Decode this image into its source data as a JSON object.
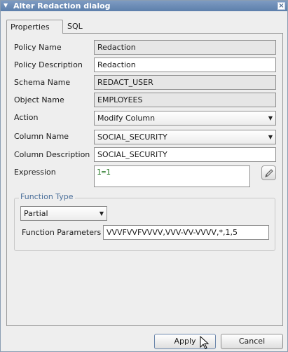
{
  "window": {
    "title": "Alter Redaction dialog"
  },
  "tabs": [
    {
      "label": "Properties",
      "active": true
    },
    {
      "label": "SQL",
      "active": false
    }
  ],
  "form": {
    "policy_name": {
      "label": "Policy Name",
      "value": "Redaction"
    },
    "policy_description": {
      "label": "Policy Description",
      "value": "Redaction"
    },
    "schema_name": {
      "label": "Schema Name",
      "value": "REDACT_USER"
    },
    "object_name": {
      "label": "Object Name",
      "value": "EMPLOYEES"
    },
    "action": {
      "label": "Action",
      "value": "Modify Column"
    },
    "column_name": {
      "label": "Column Name",
      "value": "SOCIAL_SECURITY"
    },
    "column_description": {
      "label": "Column Description",
      "value": "SOCIAL_SECURITY"
    },
    "expression": {
      "label": "Expression",
      "value": "1=1"
    }
  },
  "function_type": {
    "legend": "Function Type",
    "type_value": "Partial",
    "parameters_label": "Function Parameters",
    "parameters_value": "VVVFVVFVVVV,VVV-VV-VVVV,*,1,5"
  },
  "buttons": {
    "apply": "Apply",
    "cancel": "Cancel"
  },
  "colors": {
    "titlebar": "#5d7fab",
    "legend_text": "#4b6f9a",
    "expression_text": "#2a7a2a"
  },
  "icons": [
    "dropdown-arrow-icon",
    "pencil-icon",
    "mouse-cursor-icon"
  ]
}
